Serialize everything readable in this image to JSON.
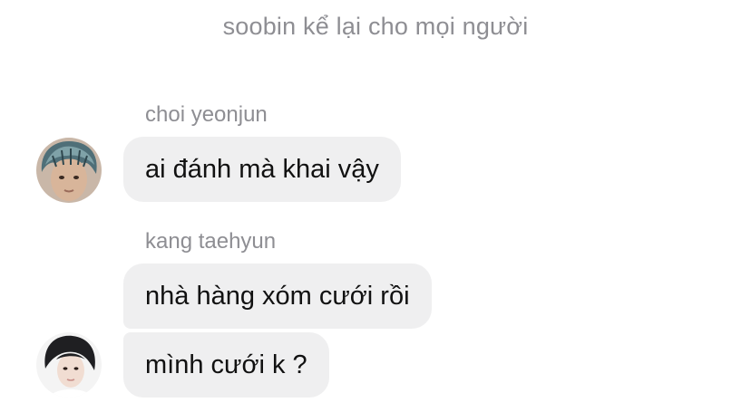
{
  "system_message": "soobin kể lại cho mọi người",
  "messages": [
    {
      "sender": "choi yeonjun",
      "texts": [
        "ai đánh mà khai vậy"
      ]
    },
    {
      "sender": "kang taehyun",
      "texts": [
        "nhà hàng xóm cưới rồi",
        "mình cưới k ?"
      ]
    }
  ],
  "colors": {
    "bubble_bg": "#efeff0",
    "meta_text": "#8e8e93",
    "message_text": "#111111"
  },
  "icons": {
    "avatar_1": "profile-photo",
    "avatar_2": "profile-photo"
  }
}
